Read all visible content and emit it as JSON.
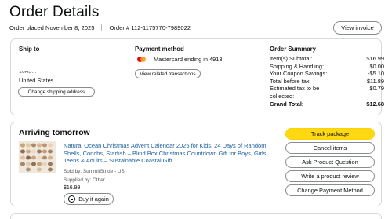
{
  "header": {
    "title": "Order Details",
    "order_placed": "Order placed November 8, 2025",
    "order_number": "Order # 112-1175770-7989022",
    "view_invoice": "View invoice"
  },
  "ship_to": {
    "title": "Ship to",
    "partial_line": "10A3...",
    "country": "United States",
    "change_button": "Change shipping address"
  },
  "payment": {
    "title": "Payment method",
    "card_text": "Mastercard ending in 4913",
    "related_button": "View related transactions"
  },
  "summary": {
    "title": "Order Summary",
    "rows": [
      {
        "label": "Item(s) Subtotal:",
        "value": "$16.99"
      },
      {
        "label": "Shipping & Handling:",
        "value": "$0.00"
      },
      {
        "label": "Your Coupon Savings:",
        "value": "-$5.10"
      },
      {
        "label": "Total before tax:",
        "value": "$11.89"
      },
      {
        "label": "Estimated tax to be collected:",
        "value": "$0.79"
      },
      {
        "label": "Grand Total:",
        "value": "$12.68"
      }
    ]
  },
  "shipment": {
    "status": "Arriving tomorrow",
    "product_title": "Natural Ocean Christmas Advent Calendar 2025 for Kids, 24 Days of Random Shells, Conchs, Starfish – Blind Box Christmas Countdown Gift for Boys, Girls, Teens & Adults – Sustainable Coastal Gift",
    "sold_by": "Sold by: SummitStride - US",
    "supplied_by": "Supplied by: Other",
    "price": "$16.99",
    "buy_again": "Buy it again",
    "actions": [
      "Track package",
      "Cancel items",
      "Ask Product Question",
      "Write a product review",
      "Change Payment Method"
    ]
  },
  "colors": {
    "primary_button": "#ffd814",
    "link": "#2162a1",
    "border": "#d5d9d9"
  }
}
